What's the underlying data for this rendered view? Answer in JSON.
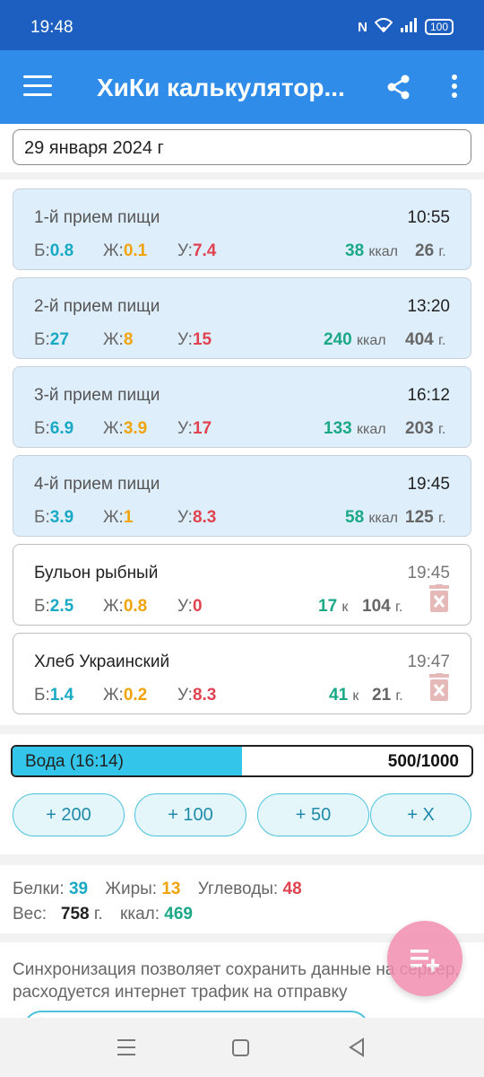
{
  "status": {
    "time": "19:48",
    "nfc": "N",
    "battery": "100"
  },
  "app": {
    "title": "ХиКи калькулятор..."
  },
  "date": {
    "value": "29 января 2024 г"
  },
  "labels": {
    "b": "Б:",
    "j": "Ж:",
    "u": "У:",
    "kcal": "ккал",
    "kcal_short": "к",
    "g": "г."
  },
  "meals": [
    {
      "name": "1-й прием пищи",
      "time": "10:55",
      "b": "0.8",
      "j": "0.1",
      "u": "7.4",
      "kcal": "38",
      "grams": "26"
    },
    {
      "name": "2-й прием пищи",
      "time": "13:20",
      "b": "27",
      "j": "8",
      "u": "15",
      "kcal": "240",
      "grams": "404"
    },
    {
      "name": "3-й прием пищи",
      "time": "16:12",
      "b": "6.9",
      "j": "3.9",
      "u": "17",
      "kcal": "133",
      "grams": "203"
    },
    {
      "name": "4-й прием пищи",
      "time": "19:45",
      "b": "3.9",
      "j": "1",
      "u": "8.3",
      "kcal": "58",
      "grams": "125"
    }
  ],
  "items": [
    {
      "name": "Бульон рыбный",
      "time": "19:45",
      "b": "2.5",
      "j": "0.8",
      "u": "0",
      "kcal": "17",
      "grams": "104"
    },
    {
      "name": "Хлеб Украинский",
      "time": "19:47",
      "b": "1.4",
      "j": "0.2",
      "u": "8.3",
      "kcal": "41",
      "grams": "21"
    }
  ],
  "water": {
    "label": "Вода (16:14)",
    "value": "500/1000",
    "fill_fraction": 0.5,
    "buttons": [
      "+ 200",
      "+ 100",
      "+ 50",
      "+ X"
    ]
  },
  "summary": {
    "protein_label": "Белки:",
    "protein": "39",
    "fat_label": "Жиры:",
    "fat": "13",
    "carbs_label": "Углеводы:",
    "carbs": "48",
    "weight_label": "Вес:",
    "weight": "758",
    "weight_unit": "г.",
    "kcal_label": "ккал:",
    "kcal": "469"
  },
  "sync": {
    "text": "Синхронизация позволяет сохранить данные на сервер, расходуется интернет трафик на отправку"
  },
  "colors": {
    "status_bar": "#1d5fc0",
    "app_bar": "#2f8ce8",
    "protein": "#19a9c4",
    "fat": "#f0a30a",
    "carbs": "#e0434f",
    "kcal": "#1aa887",
    "fab": "#f28fb1"
  }
}
